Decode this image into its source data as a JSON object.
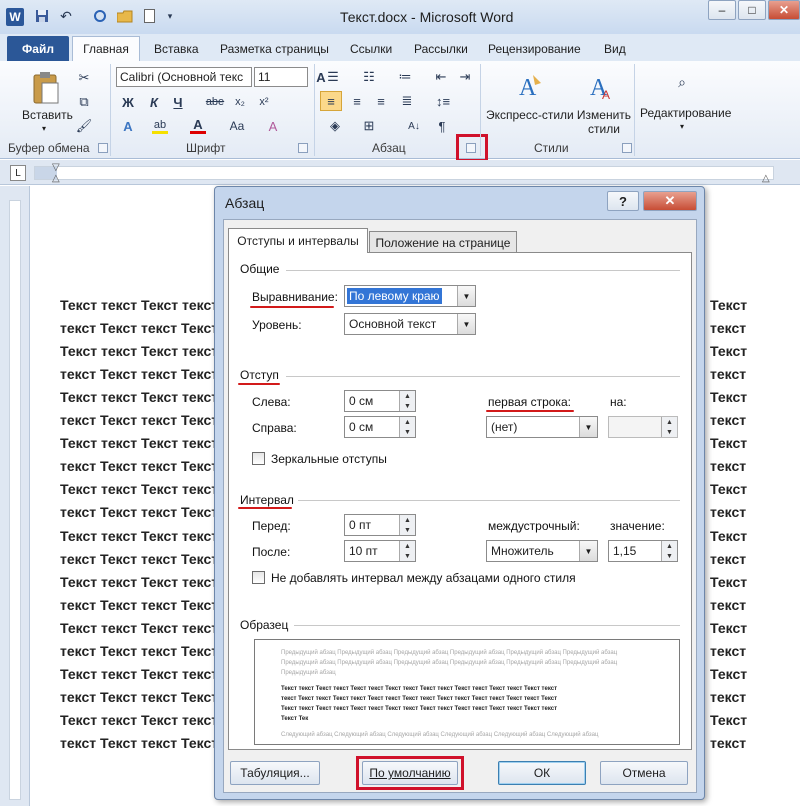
{
  "window": {
    "title": "Текст.docx - Microsoft Word"
  },
  "quick_access": {
    "icons": [
      "word-logo-icon",
      "save-icon",
      "undo-icon",
      "redo-icon",
      "open-icon",
      "new-icon",
      "customize-icon"
    ]
  },
  "tabs": [
    "Файл",
    "Главная",
    "Вставка",
    "Разметка страницы",
    "Ссылки",
    "Рассылки",
    "Рецензирование",
    "Вид"
  ],
  "ribbon": {
    "clipboard": {
      "paste_label": "Вставить",
      "group_label": "Буфер обмена"
    },
    "font": {
      "font_name": "Calibri (Основной текс",
      "font_size": "11",
      "group_label": "Шрифт",
      "bold": "Ж",
      "italic": "К",
      "underline": "Ч",
      "strike": "abe",
      "sub": "x₂",
      "sup": "x²",
      "case": "Aa"
    },
    "paragraph": {
      "group_label": "Абзац"
    },
    "styles": {
      "express_label": "Экспресс-стили",
      "change_label": "Изменить стили",
      "group_label": "Стили"
    },
    "editing": {
      "label": "Редактирование"
    }
  },
  "document": {
    "left_lines": [
      "Текст текст Текст текст",
      "текст Текст текст Текст",
      "Текст текст Текст текст",
      "текст Текст текст Текст",
      "Текст текст Текст текст",
      "текст Текст текст Текст",
      "Текст текст Текст текст",
      "текст Текст текст Текст",
      "Текст текст Текст текст",
      "текст Текст текст Текст",
      "Текст текст Текст текст",
      "текст Текст текст Текст",
      "Текст текст Текст текст",
      "текст Текст текст Текст",
      "Текст текст Текст текст",
      "текст Текст текст Текст",
      "Текст текст Текст текст",
      "текст Текст текст Текст",
      "Текст текст Текст текст",
      "текст Текст текст Текст"
    ],
    "right_lines": [
      "Текст",
      "текст",
      "Текст",
      "текст",
      "Текст",
      "текст",
      "Текст",
      "текст",
      "Текст",
      "текст",
      "Текст",
      "текст",
      "Текст",
      "текст",
      "Текст",
      "текст",
      "Текст",
      "текст",
      "Текст",
      "текст"
    ]
  },
  "dialog": {
    "title": "Абзац",
    "tabs": [
      "Отступы и интервалы",
      "Положение на странице"
    ],
    "general": {
      "heading": "Общие",
      "alignment_label": "Выравнивание:",
      "alignment_value": "По левому краю",
      "level_label": "Уровень:",
      "level_value": "Основной текст"
    },
    "indent": {
      "heading": "Отступ",
      "left_label": "Слева:",
      "left_value": "0 см",
      "right_label": "Справа:",
      "right_value": "0 см",
      "first_line_label": "первая строка:",
      "first_line_value": "(нет)",
      "by_label": "на:",
      "by_value": "",
      "mirror_label": "Зеркальные отступы"
    },
    "spacing": {
      "heading": "Интервал",
      "before_label": "Перед:",
      "before_value": "0 пт",
      "after_label": "После:",
      "after_value": "10 пт",
      "line_label": "междустрочный:",
      "line_value": "Множитель",
      "at_label": "значение:",
      "at_value": "1,15",
      "no_space_label": "Не добавлять интервал между абзацами одного стиля"
    },
    "preview": {
      "heading": "Образец",
      "grey_lines": [
        "Предыдущий абзац Предыдущий абзац Предыдущий абзац Предыдущий абзац Предыдущий абзац Предыдущий абзац",
        "Предыдущий абзац Предыдущий абзац Предыдущий абзац Предыдущий абзац Предыдущий абзац Предыдущий абзац",
        "Предыдущий абзац"
      ],
      "dark_lines": [
        "Текст текст Текст текст Текст текст Текст текст Текст текст Текст текст Текст текст Текст текст",
        "текст Текст текст Текст текст Текст текст Текст текст Текст текст Текст текст Текст текст Текст",
        "Текст текст Текст текст Текст текст Текст текст Текст текст Текст текст Текст текст Текст текст",
        "Текст Тек"
      ],
      "after_lines": [
        "Следующий абзац Следующий абзац Следующий абзац Следующий абзац Следующий абзац Следующий абзац"
      ]
    },
    "buttons": {
      "tabs": "Табуляция...",
      "default": "По умолчанию",
      "ok": "ОК",
      "cancel": "Отмена"
    }
  },
  "colors": {
    "accent_red": "#d0112b",
    "file_tab": "#2b5797"
  }
}
